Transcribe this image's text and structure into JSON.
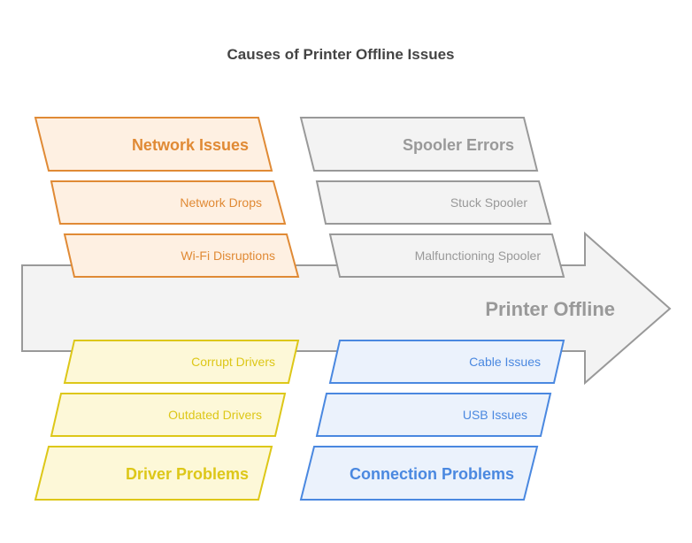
{
  "title": "Causes of Printer Offline Issues",
  "effect": "Printer Offline",
  "categories": [
    {
      "name": "Network Issues",
      "position": "top-left",
      "colors": {
        "stroke": "#E08A35",
        "fill": "#FEF0E2",
        "text": "#E08A35"
      },
      "causes": [
        "Network Drops",
        "Wi-Fi Disruptions"
      ]
    },
    {
      "name": "Spooler Errors",
      "position": "top-right",
      "colors": {
        "stroke": "#999999",
        "fill": "#F3F3F3",
        "text": "#999999"
      },
      "causes": [
        "Stuck Spooler",
        "Malfunctioning Spooler"
      ]
    },
    {
      "name": "Driver Problems",
      "position": "bottom-left",
      "colors": {
        "stroke": "#DDC718",
        "fill": "#FDF8D8",
        "text": "#DDC718"
      },
      "causes": [
        "Corrupt Drivers",
        "Outdated Drivers"
      ]
    },
    {
      "name": "Connection Problems",
      "position": "bottom-right",
      "colors": {
        "stroke": "#4A88E0",
        "fill": "#EBF2FC",
        "text": "#4A88E0"
      },
      "causes": [
        "Cable Issues",
        "USB Issues"
      ]
    }
  ],
  "arrow_colors": {
    "stroke": "#999999",
    "fill": "#F3F3F3"
  }
}
